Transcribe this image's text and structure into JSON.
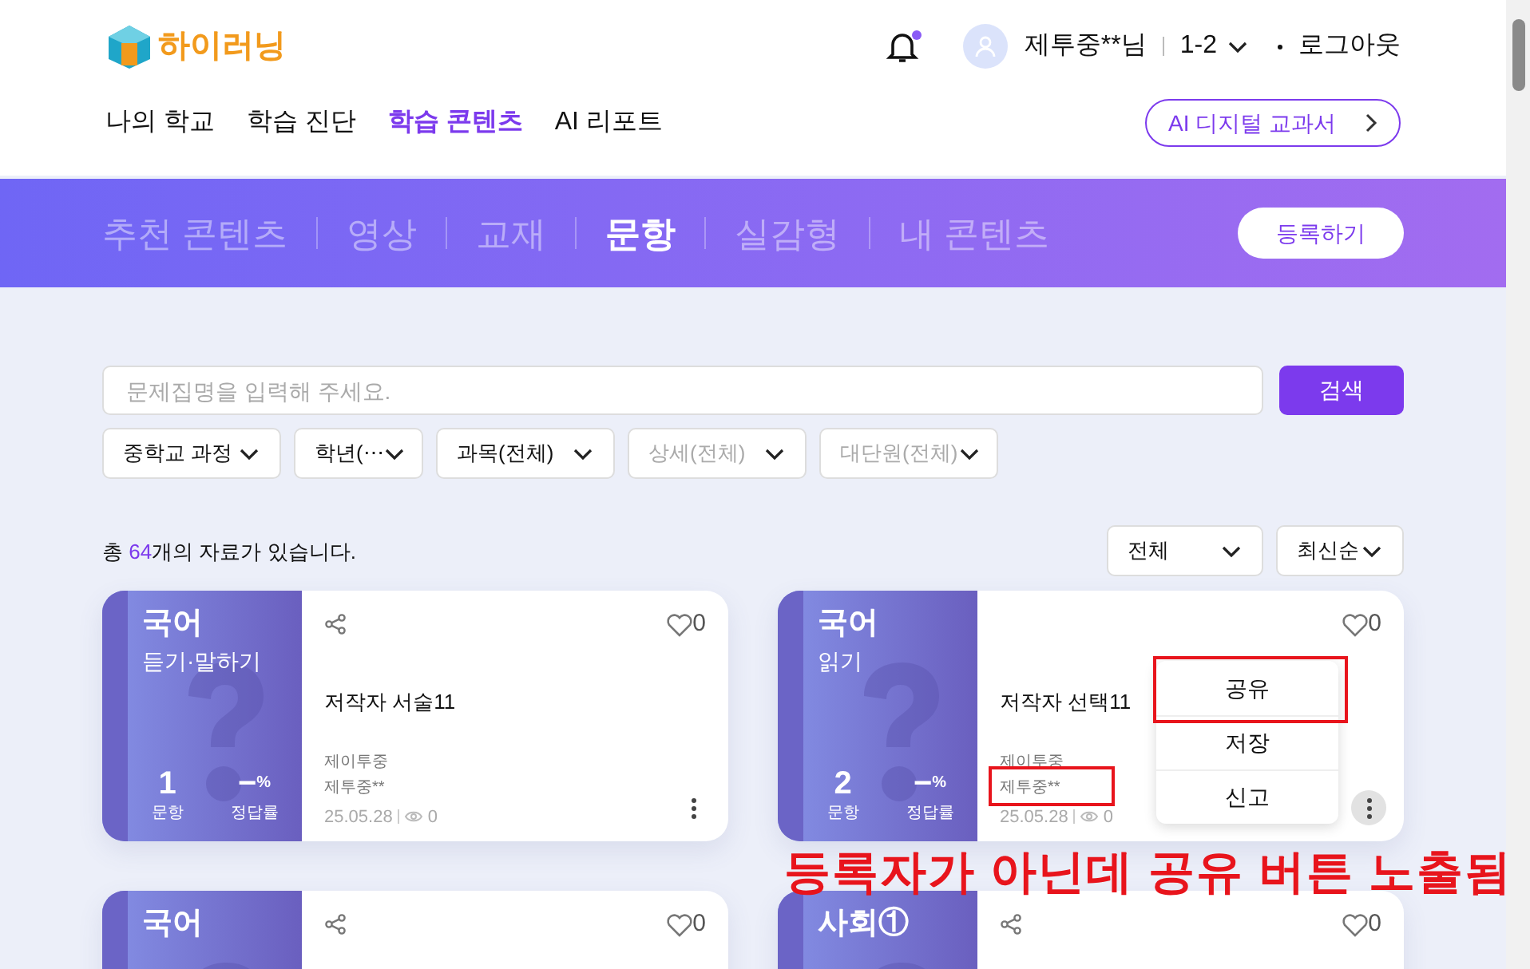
{
  "header": {
    "logo": "하이러닝",
    "user": "제투중**님",
    "grade": "1-2",
    "logout": "로그아웃",
    "notification_dot": true
  },
  "nav": [
    {
      "label": "나의 학교",
      "selected": false
    },
    {
      "label": "학습 진단",
      "selected": false
    },
    {
      "label": "학습 콘텐츠",
      "selected": true
    },
    {
      "label": "AI 리포트",
      "selected": false
    }
  ],
  "ai_button": "AI 디지털 교과서",
  "content_tabs": [
    {
      "label": "추천 콘텐츠",
      "selected": false
    },
    {
      "label": "영상",
      "selected": false
    },
    {
      "label": "교재",
      "selected": false
    },
    {
      "label": "문항",
      "selected": true
    },
    {
      "label": "실감형",
      "selected": false
    },
    {
      "label": "내 콘텐츠",
      "selected": false
    }
  ],
  "register_button": "등록하기",
  "search": {
    "placeholder": "문제집명을 입력해 주세요.",
    "button": "검색"
  },
  "filters": [
    {
      "label": "중학교 과정",
      "disabled": false
    },
    {
      "label": "학년(⋯",
      "disabled": false
    },
    {
      "label": "과목(전체)",
      "disabled": false
    },
    {
      "label": "상세(전체)",
      "disabled": true
    },
    {
      "label": "대단원(전체)",
      "disabled": true
    }
  ],
  "result_count": "총 **64**개의 자료가 있습니다.",
  "sort_selects": [
    "전체",
    "최신순"
  ],
  "cards": [
    {
      "subject": "국어",
      "detail": "듣기·말하기",
      "share_icon": true,
      "likes": "0",
      "title": "저작자 서술11",
      "school": "제이투중",
      "author": "제투중**",
      "count": "1",
      "count_label": "문항",
      "rate": "−",
      "rate_unit": "%",
      "rate_label": "정답률",
      "date": "25.05.28",
      "views": "0",
      "menu_open": false
    },
    {
      "subject": "국어",
      "detail": "읽기",
      "share_icon": false,
      "likes": "0",
      "title": "저작자 선택11",
      "school": "제이투중",
      "author": "제투중**",
      "count": "2",
      "count_label": "문항",
      "rate": "−",
      "rate_unit": "%",
      "rate_label": "정답률",
      "date": "25.05.28",
      "views": "0",
      "menu_open": true,
      "menu": [
        "공유",
        "저장",
        "신고"
      ],
      "annotation": "등록자가 아닌데 공유 버튼 노출됨"
    },
    {
      "subject": "국어",
      "share_icon": true,
      "likes": "0"
    },
    {
      "subject": "사회①",
      "share_icon": true,
      "likes": "0"
    }
  ]
}
